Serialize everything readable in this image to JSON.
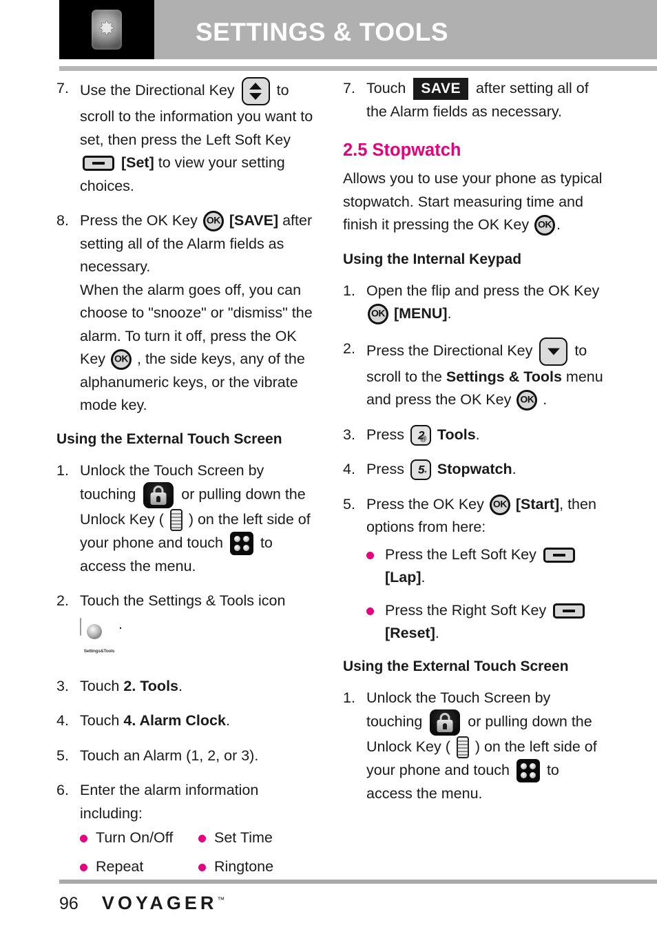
{
  "header": {
    "title": "SETTINGS & TOOLS",
    "icon": "settings-gear-icon"
  },
  "colors": {
    "accent_magenta": "#e6007e",
    "header_band": "#b0b0b0",
    "rule": "#b6b6b6",
    "text": "#1a1a1a"
  },
  "left_column": {
    "steps": [
      {
        "num": "7.",
        "parts": [
          {
            "t": "text",
            "v": "Use the Directional Key "
          },
          {
            "t": "icon",
            "v": "directional-key-icon"
          },
          {
            "t": "text",
            "v": " to scroll to the information you want to set, then press the Left Soft Key "
          },
          {
            "t": "icon",
            "v": "soft-key-icon"
          },
          {
            "t": "bold",
            "v": " [Set]"
          },
          {
            "t": "text",
            "v": " to view your setting choices."
          }
        ]
      },
      {
        "num": "8.",
        "parts": [
          {
            "t": "text",
            "v": "Press the OK Key "
          },
          {
            "t": "icon",
            "v": "ok-key-icon"
          },
          {
            "t": "bold",
            "v": " [SAVE]"
          },
          {
            "t": "text",
            "v": " after setting all of the Alarm fields as necessary."
          },
          {
            "t": "break",
            "v": ""
          },
          {
            "t": "text",
            "v": "When the alarm goes off, you can choose to \"snooze\" or \"dismiss\" the alarm. To turn it off, press the OK Key "
          },
          {
            "t": "icon",
            "v": "ok-key-icon"
          },
          {
            "t": "text",
            "v": " , the side keys, any of the alphanumeric keys, or the vibrate mode key."
          }
        ]
      }
    ],
    "subheading": "Using the External Touch Screen",
    "touch_steps": [
      {
        "num": "1.",
        "parts": [
          {
            "t": "text",
            "v": "Unlock the Touch Screen by touching "
          },
          {
            "t": "icon",
            "v": "lock-icon"
          },
          {
            "t": "text",
            "v": " or pulling down the Unlock Key ( "
          },
          {
            "t": "icon",
            "v": "unlock-side-key-icon"
          },
          {
            "t": "text",
            "v": " ) on the left side of your phone and touch "
          },
          {
            "t": "icon",
            "v": "menu-grid-icon"
          },
          {
            "t": "text",
            "v": " to access the menu."
          }
        ]
      },
      {
        "num": "2.",
        "parts": [
          {
            "t": "text",
            "v": "Touch the Settings & Tools icon "
          },
          {
            "t": "icon",
            "v": "settings-tools-app-icon"
          },
          {
            "t": "text",
            "v": "."
          }
        ]
      },
      {
        "num": "3.",
        "parts": [
          {
            "t": "text",
            "v": "Touch "
          },
          {
            "t": "bold",
            "v": "2. Tools"
          },
          {
            "t": "text",
            "v": "."
          }
        ]
      },
      {
        "num": "4.",
        "parts": [
          {
            "t": "text",
            "v": "Touch "
          },
          {
            "t": "bold",
            "v": "4. Alarm Clock"
          },
          {
            "t": "text",
            "v": "."
          }
        ]
      },
      {
        "num": "5.",
        "parts": [
          {
            "t": "text",
            "v": "Touch an Alarm (1, 2, or 3)."
          }
        ]
      },
      {
        "num": "6.",
        "parts": [
          {
            "t": "text",
            "v": "Enter the alarm information including:"
          }
        ]
      }
    ],
    "alarm_options": {
      "column1": [
        "Turn On/Off",
        "Repeat"
      ],
      "column2": [
        "Set Time",
        "Ringtone"
      ]
    },
    "app_icon_caption": "Settings&Tools"
  },
  "right_column": {
    "step7": {
      "num": "7.",
      "pre": "Touch ",
      "save_tag": "SAVE",
      "post": " after setting all of the Alarm fields as necessary."
    },
    "section_heading": "2.5 Stopwatch",
    "intro_parts": [
      {
        "t": "text",
        "v": "Allows you to use your phone as typical stopwatch. Start measuring time and finish it pressing the OK Key "
      },
      {
        "t": "icon",
        "v": "ok-key-icon"
      },
      {
        "t": "text",
        "v": "."
      }
    ],
    "keypad_subheading": "Using the Internal Keypad",
    "keypad_steps": [
      {
        "num": "1.",
        "parts": [
          {
            "t": "text",
            "v": "Open the flip and press the OK Key "
          },
          {
            "t": "icon",
            "v": "ok-key-icon"
          },
          {
            "t": "bold",
            "v": " [MENU]"
          },
          {
            "t": "text",
            "v": "."
          }
        ]
      },
      {
        "num": "2.",
        "parts": [
          {
            "t": "text",
            "v": "Press the Directional Key "
          },
          {
            "t": "icon",
            "v": "directional-key-down-icon"
          },
          {
            "t": "text",
            "v": " to scroll to the "
          },
          {
            "t": "bold",
            "v": "Settings & Tools"
          },
          {
            "t": "text",
            "v": " menu and press the OK Key "
          },
          {
            "t": "icon",
            "v": "ok-key-icon"
          },
          {
            "t": "text",
            "v": " ."
          }
        ]
      },
      {
        "num": "3.",
        "parts": [
          {
            "t": "text",
            "v": "Press "
          },
          {
            "t": "icon",
            "v": "keypad-key-2-icon"
          },
          {
            "t": "bold",
            "v": " Tools"
          },
          {
            "t": "text",
            "v": "."
          }
        ]
      },
      {
        "num": "4.",
        "parts": [
          {
            "t": "text",
            "v": "Press "
          },
          {
            "t": "icon",
            "v": "keypad-key-5-icon"
          },
          {
            "t": "bold",
            "v": " Stopwatch"
          },
          {
            "t": "text",
            "v": "."
          }
        ]
      },
      {
        "num": "5.",
        "parts": [
          {
            "t": "text",
            "v": "Press the OK Key "
          },
          {
            "t": "icon",
            "v": "ok-key-icon"
          },
          {
            "t": "bold",
            "v": " [Start]"
          },
          {
            "t": "text",
            "v": ", then options from here:"
          }
        ]
      }
    ],
    "stopwatch_options": [
      {
        "parts": [
          {
            "t": "text",
            "v": "Press the Left Soft Key "
          },
          {
            "t": "icon",
            "v": "soft-key-icon"
          },
          {
            "t": "break",
            "v": ""
          },
          {
            "t": "bold",
            "v": "[Lap]"
          },
          {
            "t": "text",
            "v": "."
          }
        ]
      },
      {
        "parts": [
          {
            "t": "text",
            "v": "Press the Right Soft Key "
          },
          {
            "t": "icon",
            "v": "soft-key-icon"
          },
          {
            "t": "break",
            "v": ""
          },
          {
            "t": "bold",
            "v": "[Reset]"
          },
          {
            "t": "text",
            "v": "."
          }
        ]
      }
    ],
    "touch_subheading": "Using the External Touch Screen",
    "touch_steps": [
      {
        "num": "1.",
        "parts": [
          {
            "t": "text",
            "v": "Unlock the Touch Screen by touching "
          },
          {
            "t": "icon",
            "v": "lock-icon"
          },
          {
            "t": "text",
            "v": " or pulling down the Unlock Key ( "
          },
          {
            "t": "icon",
            "v": "unlock-side-key-icon"
          },
          {
            "t": "text",
            "v": " ) on the left side of your phone and touch "
          },
          {
            "t": "icon",
            "v": "menu-grid-icon"
          },
          {
            "t": "text",
            "v": " to access the menu."
          }
        ]
      }
    ]
  },
  "keypad_keys": {
    "two": {
      "digit": "2",
      "sup": "@"
    },
    "five": {
      "digit": "5",
      "sup": "*"
    }
  },
  "footer": {
    "page_number": "96",
    "brand": "VOYAGER",
    "trademark": "™"
  }
}
